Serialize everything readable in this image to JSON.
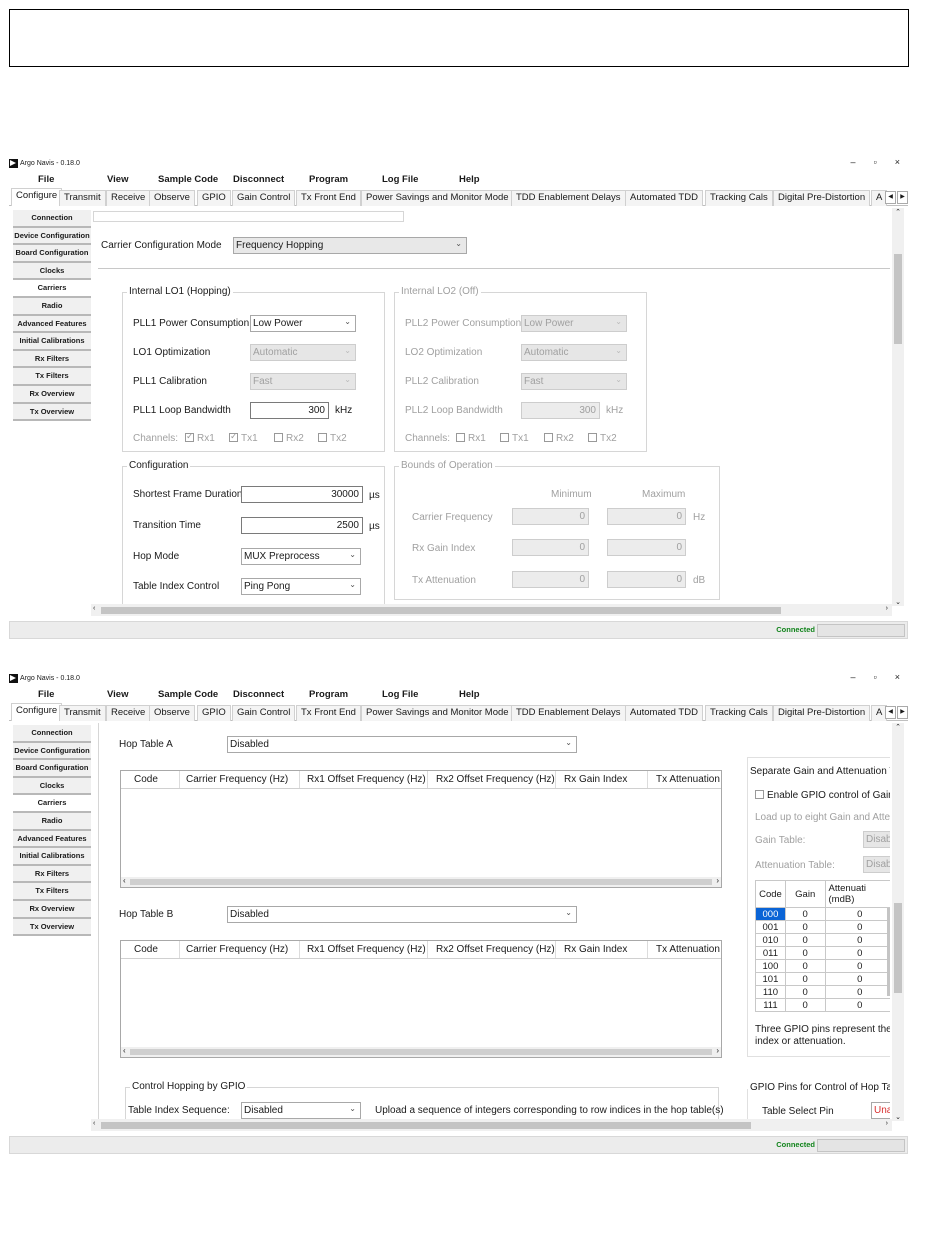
{
  "window": {
    "title": "Argo Navis - 0.18.0",
    "minimize": "–",
    "maximize": "▫",
    "close": "×"
  },
  "menu": [
    "File",
    "View",
    "Sample Code",
    "Disconnect",
    "Program",
    "Log File",
    "Help"
  ],
  "tabs": [
    "Configure",
    "Transmit",
    "Receive",
    "Observe",
    "GPIO",
    "Gain Control",
    "Tx Front End",
    "Power Savings and Monitor Mode",
    "TDD Enablement Delays",
    "Automated TDD",
    "Tracking Cals",
    "Digital Pre-Distortion",
    "A"
  ],
  "active_tab": "Configure",
  "nav": [
    "Connection",
    "Device Configuration",
    "Board Configuration",
    "Clocks",
    "Carriers",
    "Radio",
    "Advanced Features",
    "Initial Calibrations",
    "Rx Filters",
    "Tx Filters",
    "Rx Overview",
    "Tx Overview"
  ],
  "active_nav": "Carriers",
  "status": {
    "text": "Connected"
  },
  "carrier": {
    "mode_label": "Carrier Configuration Mode",
    "mode_value": "Frequency Hopping"
  },
  "lo1": {
    "title": "Internal LO1 (Hopping)",
    "power_label": "PLL1 Power Consumption",
    "power_value": "Low Power",
    "opt_label": "LO1 Optimization",
    "opt_value": "Automatic",
    "cal_label": "PLL1 Calibration",
    "cal_value": "Fast",
    "bw_label": "PLL1 Loop Bandwidth",
    "bw_value": "300",
    "bw_unit": "kHz",
    "channels_label": "Channels:",
    "channels": [
      {
        "name": "Rx1",
        "checked": true
      },
      {
        "name": "Tx1",
        "checked": true
      },
      {
        "name": "Rx2",
        "checked": false
      },
      {
        "name": "Tx2",
        "checked": false
      }
    ]
  },
  "lo2": {
    "title": "Internal LO2 (Off)",
    "power_label": "PLL2 Power Consumption",
    "power_value": "Low Power",
    "opt_label": "LO2 Optimization",
    "opt_value": "Automatic",
    "cal_label": "PLL2 Calibration",
    "cal_value": "Fast",
    "bw_label": "PLL2 Loop Bandwidth",
    "bw_value": "300",
    "bw_unit": "kHz",
    "channels_label": "Channels:",
    "channels": [
      {
        "name": "Rx1",
        "checked": false
      },
      {
        "name": "Tx1",
        "checked": false
      },
      {
        "name": "Rx2",
        "checked": false
      },
      {
        "name": "Tx2",
        "checked": false
      }
    ]
  },
  "config": {
    "title": "Configuration",
    "frame_label": "Shortest Frame Duration",
    "frame_value": "30000",
    "frame_unit": "µs",
    "transition_label": "Transition Time",
    "transition_value": "2500",
    "transition_unit": "µs",
    "hop_mode_label": "Hop Mode",
    "hop_mode_value": "MUX Preprocess",
    "table_index_label": "Table Index Control",
    "table_index_value": "Ping Pong"
  },
  "bounds": {
    "title": "Bounds of Operation",
    "min_header": "Minimum",
    "max_header": "Maximum",
    "rows": [
      {
        "label": "Carrier Frequency",
        "min": "0",
        "max": "0",
        "unit": "Hz"
      },
      {
        "label": "Rx Gain Index",
        "min": "0",
        "max": "0",
        "unit": ""
      },
      {
        "label": "Tx Attenuation",
        "min": "0",
        "max": "0",
        "unit": "dB"
      }
    ]
  },
  "hop_a": {
    "label": "Hop Table A",
    "value": "Disabled",
    "columns": [
      "Code",
      "Carrier Frequency (Hz)",
      "Rx1 Offset Frequency (Hz)",
      "Rx2 Offset Frequency (Hz)",
      "Rx Gain Index",
      "Tx Attenuation ("
    ]
  },
  "hop_b": {
    "label": "Hop Table B",
    "value": "Disabled",
    "columns": [
      "Code",
      "Carrier Frequency (Hz)",
      "Rx1 Offset Frequency (Hz)",
      "Rx2 Offset Frequency (Hz)",
      "Rx Gain Index",
      "Tx Attenuation ("
    ]
  },
  "gpio_hop": {
    "title": "Control Hopping by GPIO",
    "seq_label": "Table Index Sequence:",
    "seq_value": "Disabled",
    "upload_text": "Upload a sequence of integers corresponding to row indices in the hop table(s)"
  },
  "sep_gain": {
    "title": "Separate Gain and Attenuation Ta",
    "enable_label": "Enable GPIO control of Gain a",
    "load_text": "Load up to eight Gain and Attenu",
    "gain_table_label": "Gain Table:",
    "gain_table_value": "Disab",
    "atten_table_label": "Attenuation Table:",
    "atten_table_value": "Disab",
    "col_code": "Code",
    "col_gain": "Gain",
    "col_atten_1": "Attenuati",
    "col_atten_2": "(mdB)",
    "rows": [
      {
        "code": "000",
        "gain": "0",
        "atten": "0"
      },
      {
        "code": "001",
        "gain": "0",
        "atten": "0"
      },
      {
        "code": "010",
        "gain": "0",
        "atten": "0"
      },
      {
        "code": "011",
        "gain": "0",
        "atten": "0"
      },
      {
        "code": "100",
        "gain": "0",
        "atten": "0"
      },
      {
        "code": "101",
        "gain": "0",
        "atten": "0"
      },
      {
        "code": "110",
        "gain": "0",
        "atten": "0"
      },
      {
        "code": "111",
        "gain": "0",
        "atten": "0"
      }
    ],
    "note_1": "Three GPIO pins represent the co",
    "note_2": "index or attenuation."
  },
  "gpio_pins": {
    "title": "GPIO Pins for Control of Hop Table",
    "select_label": "Table Select Pin",
    "select_value": "Una"
  }
}
